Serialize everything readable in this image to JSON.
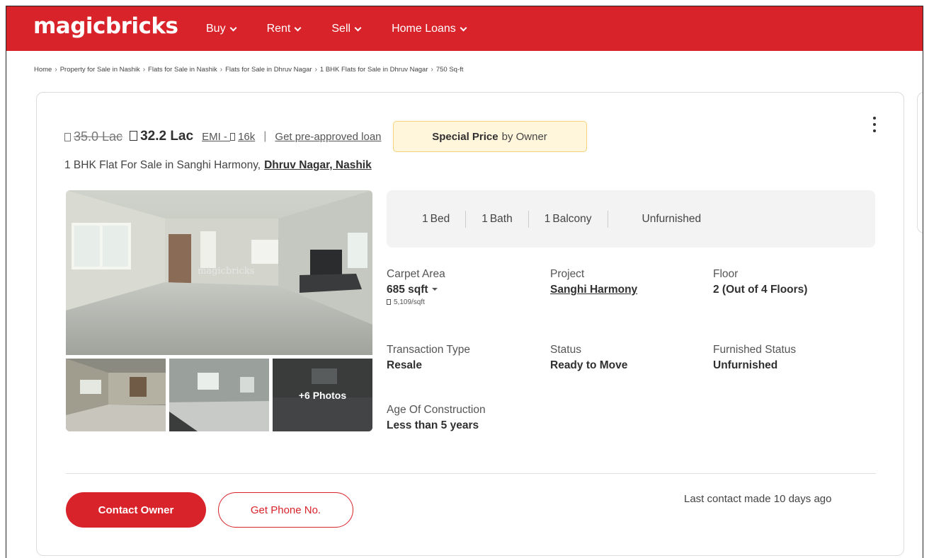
{
  "header": {
    "logo": "magicbricks",
    "nav": [
      {
        "label": "Buy"
      },
      {
        "label": "Rent"
      },
      {
        "label": "Sell"
      },
      {
        "label": "Home Loans"
      }
    ]
  },
  "breadcrumb": [
    "Home",
    "Property for Sale in Nashik",
    "Flats for Sale in Nashik",
    "Flats for Sale in Dhruv Nagar",
    "1 BHK Flats for Sale in Dhruv Nagar",
    "750 Sq-ft"
  ],
  "listing": {
    "old_price": "35.0 Lac",
    "price": "32.2 Lac",
    "emi_prefix": "EMI - ",
    "emi_value": "16k",
    "separator": "|",
    "loan_link": "Get pre-approved loan",
    "special_bold": "Special Price",
    "special_rest": "by Owner",
    "title": "1 BHK Flat For Sale in Sanghi Harmony,",
    "location": "Dhruv Nagar, Nashik",
    "more_photos": "+6 Photos",
    "photo_watermark": "magicbricks",
    "summary": [
      {
        "num": "1",
        "label": "Bed"
      },
      {
        "num": "1",
        "label": "Bath"
      },
      {
        "num": "1",
        "label": "Balcony"
      },
      {
        "num": "",
        "label": "Unfurnished"
      }
    ],
    "details": {
      "carpet_label": "Carpet Area",
      "carpet_value": "685 sqft",
      "carpet_rate": "5,109/sqft",
      "project_label": "Project",
      "project_value": "Sanghi Harmony",
      "floor_label": "Floor",
      "floor_value": "2 (Out of 4 Floors)",
      "transaction_label": "Transaction Type",
      "transaction_value": "Resale",
      "status_label": "Status",
      "status_value": "Ready to Move",
      "furnished_label": "Furnished Status",
      "furnished_value": "Unfurnished",
      "age_label": "Age Of Construction",
      "age_value": "Less than 5 years"
    },
    "contact_button": "Contact Owner",
    "phone_button": "Get Phone No.",
    "last_contact": "Last contact made 10 days ago"
  },
  "colors": {
    "brand": "#d8232a",
    "special_bg": "#fff6dc"
  }
}
